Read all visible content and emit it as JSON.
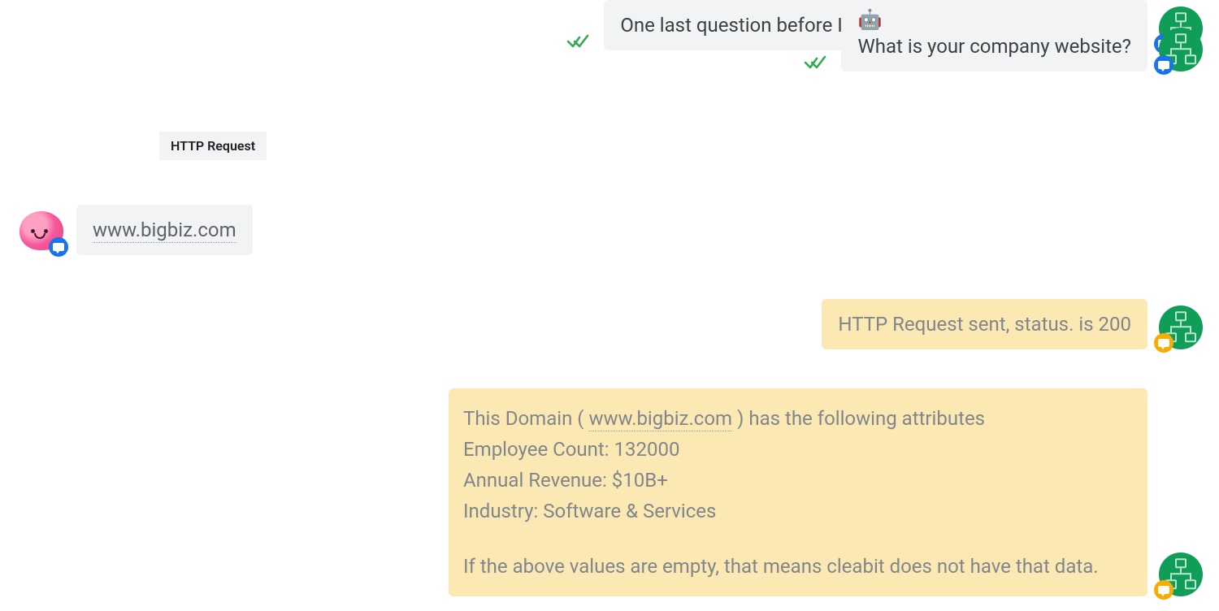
{
  "tooltip": {
    "label": "HTTP Request"
  },
  "bot": {
    "msg1": "One last question before I can assign you to the sales team",
    "msg2_line1_emoji": "🤖",
    "msg2_line2": "What is your company website?"
  },
  "user": {
    "reply_link": "www.bigbiz.com"
  },
  "status": {
    "text": "HTTP Request sent, status. is 200"
  },
  "details": {
    "intro_prefix": "This Domain ( ",
    "intro_link": "www.bigbiz.com",
    "intro_suffix": " ) has the following attributes",
    "employee_label": "Employee Count: ",
    "employee_value": "132000",
    "revenue_label": "Annual Revenue: ",
    "revenue_value": "$10B+",
    "industry_label": "Industry: ",
    "industry_value": "Software & Services",
    "footer": "If the above values are empty, that means cleabit does not have that data."
  }
}
